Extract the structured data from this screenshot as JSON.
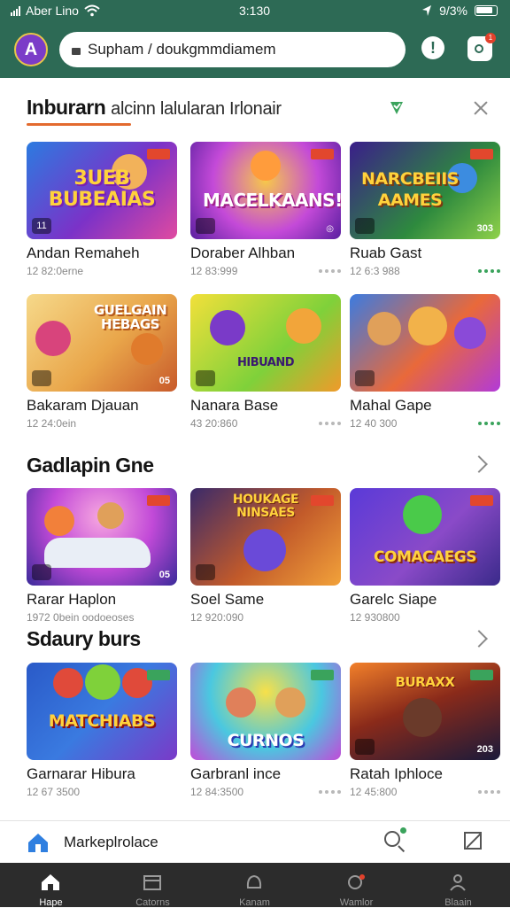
{
  "status_bar": {
    "carrier": "Aber Lino",
    "time": "3:130",
    "battery": "9/3%"
  },
  "address_bar": {
    "avatar_letter": "A",
    "url": "Supham / doukgmmdiamem",
    "notification_count": "1"
  },
  "sections": [
    {
      "title": "Inburarn",
      "subtitle": "alcinn lalularan Irlonair",
      "cards": [
        {
          "image_text": "3UEB BUBEAIAS",
          "name": "Andan Remaheh",
          "meta": "12 82:0erne",
          "badge_left": "11",
          "badge_right": ""
        },
        {
          "image_text": "MACELKAANS!",
          "name": "Doraber Alhban",
          "meta": "12 83:999",
          "badge_left": "",
          "badge_right": ""
        },
        {
          "image_text": "NARCBEIIS AAMES",
          "name": "Ruab Gast",
          "meta": "12 6:3 988",
          "badge_left": "",
          "badge_right": "303"
        },
        {
          "image_text": "GUELGAIN HEBAGS",
          "name": "Bakaram Djauan",
          "meta": "12 24:0ein",
          "badge_left": "",
          "badge_right": "05"
        },
        {
          "image_text": "HIBUAND",
          "name": "Nanara Base",
          "meta": "43 20:860",
          "badge_left": "",
          "badge_right": ""
        },
        {
          "image_text": "",
          "name": "Mahal Gape",
          "meta": "12 40 300",
          "badge_left": "",
          "badge_right": ""
        }
      ]
    },
    {
      "title": "Gadlapin Gne",
      "cards": [
        {
          "image_text": "",
          "name": "Rarar Haplon",
          "meta": "1972 0bein  oodoeoses",
          "badge_left": "",
          "badge_right": "05"
        },
        {
          "image_text": "HOUKAGE NINSAES",
          "name": "Soel Same",
          "meta": "12 920:090",
          "badge_left": "",
          "badge_right": ""
        },
        {
          "image_text": "COMACAEGS",
          "name": "Garelc Siape",
          "meta": "12 930800",
          "badge_left": "",
          "badge_right": ""
        }
      ]
    },
    {
      "title": "Sdaury burs",
      "cards": [
        {
          "image_text": "MATCHIABS",
          "name": "Garnarar Hibura",
          "meta": "12 67 3500",
          "badge_left": "",
          "badge_right": ""
        },
        {
          "image_text": "CURNOS",
          "name": "Garbranl ince",
          "meta": "12 84:3500",
          "badge_left": "",
          "badge_right": ""
        },
        {
          "image_text": "BURAXX",
          "name": "Ratah Iphloce",
          "meta": "12 45:800",
          "badge_left": "",
          "badge_right": "203"
        }
      ]
    }
  ],
  "tab_strip": {
    "label": "Markeplrolace"
  },
  "bottom_nav": [
    "Hape",
    "Catorns",
    "Kanam",
    "Wamlor",
    "Blaain"
  ],
  "colors": {
    "theme": "#2d6a55",
    "accent": "#e36a2e",
    "nav_bg": "#2c2c2c",
    "highlight": "#3aa35c"
  },
  "icons": [
    "wifi-icon",
    "signal-icon",
    "battery-icon",
    "lock-icon",
    "alert-icon",
    "notification-icon",
    "close-icon",
    "chevron-right-icon",
    "home-icon",
    "search-icon",
    "bookmark-icon",
    "store-icon",
    "gamepad-icon",
    "user-icon",
    "gift-icon"
  ]
}
